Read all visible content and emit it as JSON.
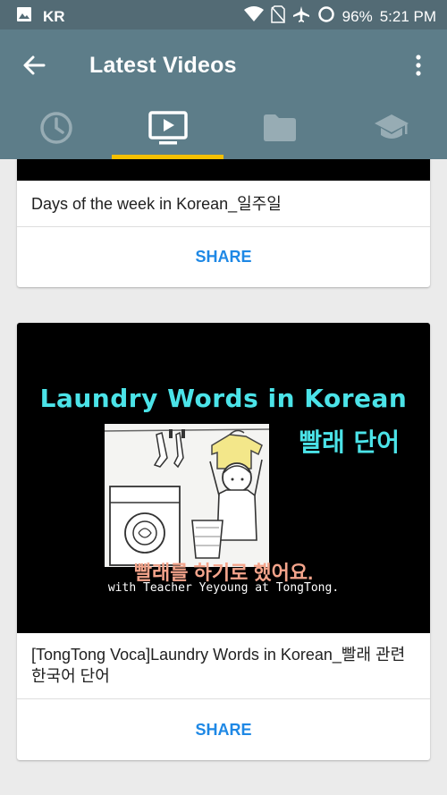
{
  "status_bar": {
    "carrier": "KR",
    "battery": "96%",
    "time": "5:21 PM",
    "icons": [
      "image-icon",
      "wifi-icon",
      "no-sim-icon",
      "airplane-icon",
      "battery-icon"
    ]
  },
  "app_bar": {
    "title": "Latest Videos",
    "background": "#5d7d89"
  },
  "tabs": [
    {
      "icon": "clock-icon",
      "active": false
    },
    {
      "icon": "video-icon",
      "active": true
    },
    {
      "icon": "folder-icon",
      "active": false
    },
    {
      "icon": "graduation-cap-icon",
      "active": false
    }
  ],
  "accent_color": "#f5c000",
  "videos": [
    {
      "title": "Days of the week in Korean_일주일",
      "share_label": "SHARE"
    },
    {
      "title": "[TongTong Voca]Laundry Words in Korean_빨래 관련 한국어 단어",
      "share_label": "SHARE",
      "thumbnail": {
        "heading": "Laundry Words in Korean",
        "heading_ko": "빨래 단어",
        "caption_ko": "빨래를 하기로 했어요.",
        "caption_en": "with Teacher Yeyoung at TongTong."
      }
    }
  ]
}
